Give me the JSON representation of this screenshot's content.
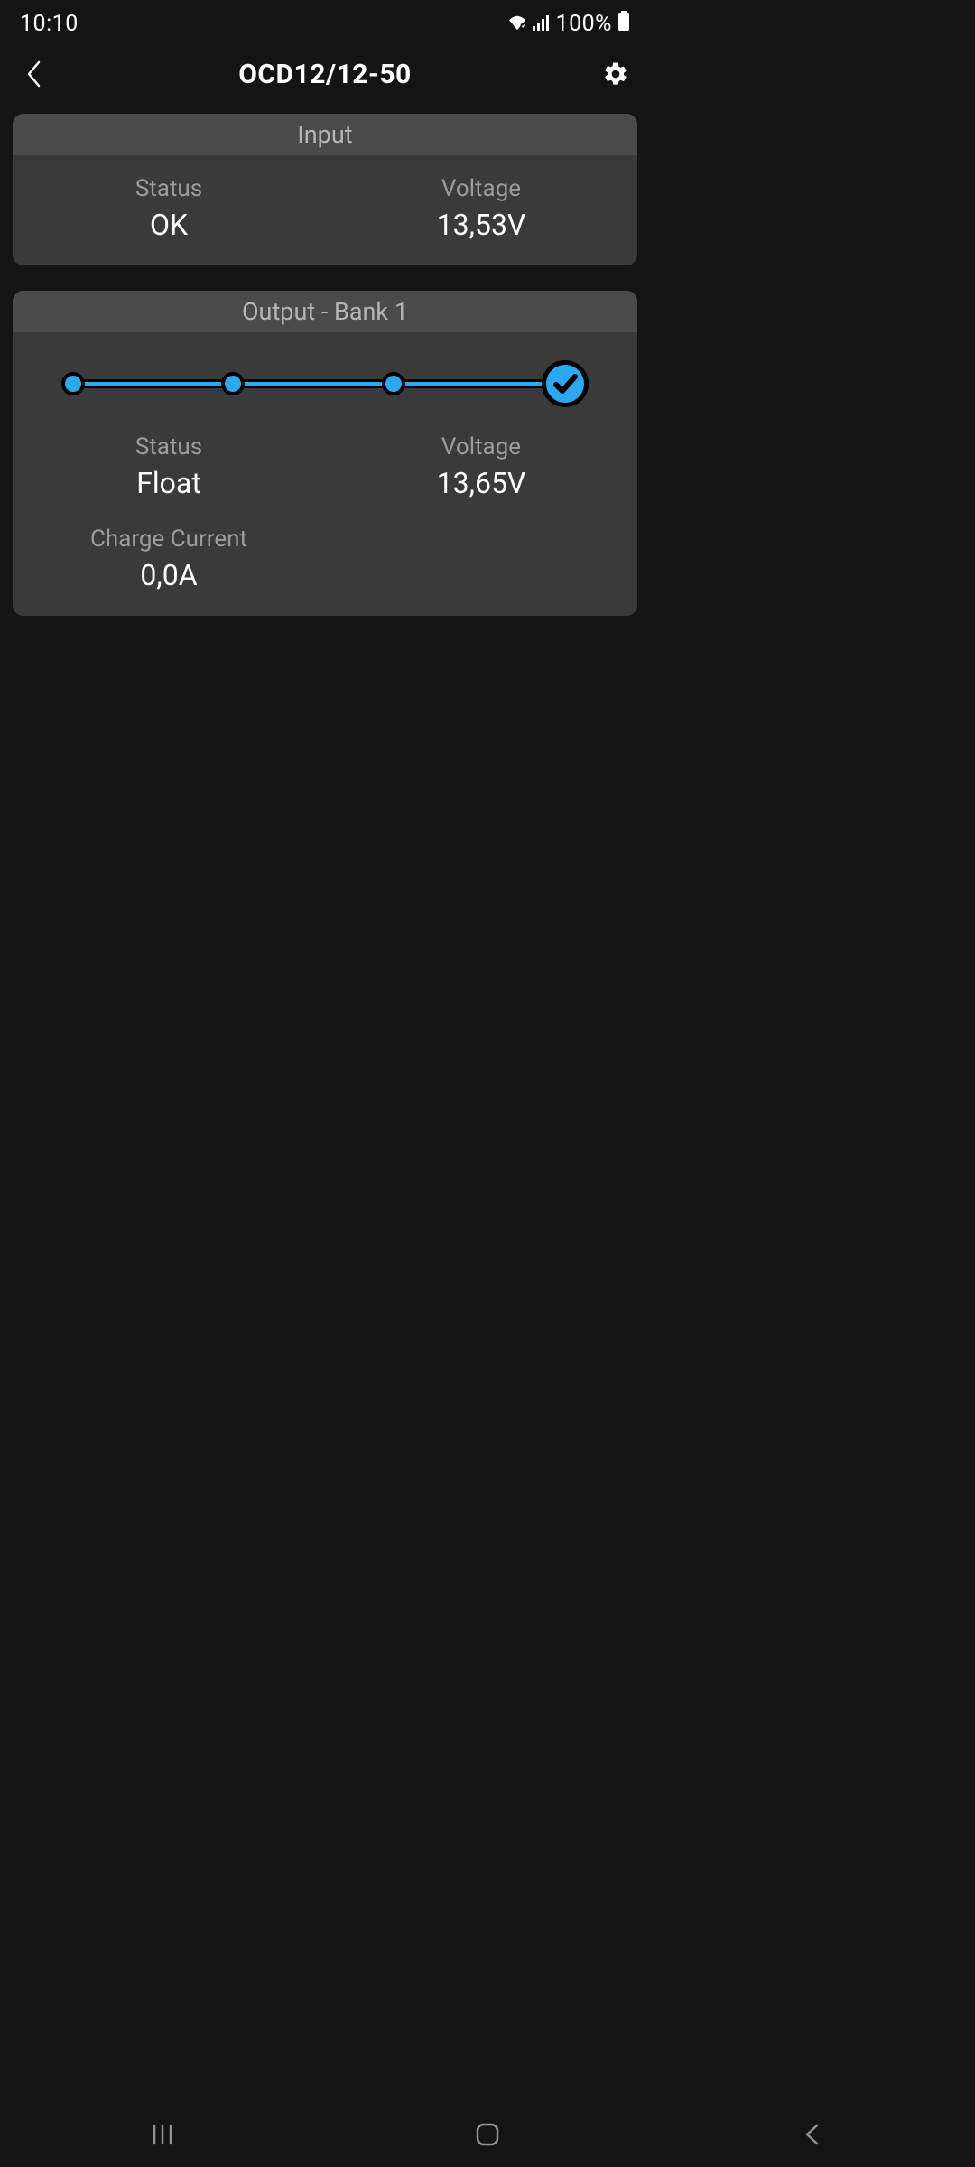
{
  "status_bar": {
    "time": "10:10",
    "battery_pct": "100%"
  },
  "header": {
    "title": "OCD12/12-50"
  },
  "input_card": {
    "title": "Input",
    "status_label": "Status",
    "status_value": "OK",
    "voltage_label": "Voltage",
    "voltage_value": "13,53V"
  },
  "output_card": {
    "title": "Output - Bank 1",
    "status_label": "Status",
    "status_value": "Float",
    "voltage_label": "Voltage",
    "voltage_value": "13,65V",
    "current_label": "Charge Current",
    "current_value": "0,0A",
    "progress_steps": 4,
    "progress_complete": 4
  }
}
